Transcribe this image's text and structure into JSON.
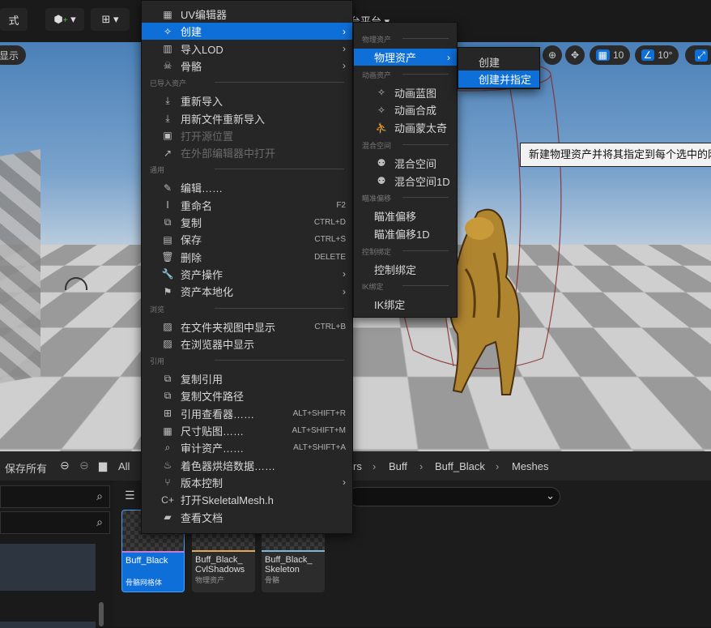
{
  "toolbar": {
    "mode_label": "式",
    "platform_label": "台平台"
  },
  "viewport": {
    "show_label": "显示",
    "grid_value": "10",
    "angle_value": "10°",
    "tooltip": "新建物理资产并将其指定到每个选中的网格"
  },
  "context_menu": {
    "items": [
      {
        "icon": "grid-icon",
        "glyph": "▦",
        "label": "UV编辑器"
      },
      {
        "icon": "create-icon",
        "glyph": "✧",
        "label": "创建",
        "highlight": true,
        "submenu": true
      },
      {
        "icon": "import-lod-icon",
        "glyph": "▥",
        "label": "导入LOD",
        "submenu": true
      },
      {
        "icon": "skeleton-icon",
        "glyph": "☠",
        "label": "骨骼",
        "submenu": true
      },
      {
        "section": "已导入资产"
      },
      {
        "icon": "reimport-icon",
        "glyph": "⤓",
        "label": "重新导入"
      },
      {
        "icon": "reimport-new-file-icon",
        "glyph": "⤓",
        "label": "用新文件重新导入"
      },
      {
        "icon": "open-source-icon",
        "glyph": "▣",
        "label": "打开源位置",
        "disabled": true
      },
      {
        "icon": "external-editor-icon",
        "glyph": "↗",
        "label": "在外部编辑器中打开",
        "disabled": true
      },
      {
        "section": "通用"
      },
      {
        "icon": "edit-icon",
        "glyph": "✎",
        "label": "编辑……"
      },
      {
        "icon": "rename-icon",
        "glyph": "Ⅰ",
        "label": "重命名",
        "shortcut": "F2"
      },
      {
        "icon": "duplicate-icon",
        "glyph": "⧉",
        "label": "复制",
        "shortcut": "CTRL+D"
      },
      {
        "icon": "save-icon",
        "glyph": "▤",
        "label": "保存",
        "shortcut": "CTRL+S"
      },
      {
        "icon": "delete-icon",
        "glyph": "🗑",
        "label": "删除",
        "shortcut": "DELETE"
      },
      {
        "icon": "wrench-icon",
        "glyph": "🔧",
        "label": "资产操作",
        "submenu": true
      },
      {
        "icon": "flag-icon",
        "glyph": "⚑",
        "label": "资产本地化",
        "submenu": true
      },
      {
        "section": "浏览"
      },
      {
        "icon": "folder-search-icon",
        "glyph": "▨",
        "label": "在文件夹视图中显示",
        "shortcut": "CTRL+B"
      },
      {
        "icon": "browser-search-icon",
        "glyph": "▨",
        "label": "在浏览器中显示"
      },
      {
        "section": "引用"
      },
      {
        "icon": "copy-ref-icon",
        "glyph": "⧉",
        "label": "复制引用"
      },
      {
        "icon": "copy-path-icon",
        "glyph": "⧉",
        "label": "复制文件路径"
      },
      {
        "icon": "ref-viewer-icon",
        "glyph": "⊞",
        "label": "引用查看器……",
        "shortcut": "ALT+SHIFT+R"
      },
      {
        "icon": "size-map-icon",
        "glyph": "▦",
        "label": "尺寸贴图……",
        "shortcut": "ALT+SHIFT+M"
      },
      {
        "icon": "audit-icon",
        "glyph": "⌕",
        "label": "审计资产……",
        "shortcut": "ALT+SHIFT+A"
      },
      {
        "icon": "shader-bake-icon",
        "glyph": "♨",
        "label": "着色器烘焙数据……"
      },
      {
        "icon": "version-control-icon",
        "glyph": "⑂",
        "label": "版本控制",
        "submenu": true
      },
      {
        "icon": "cpp-file-icon",
        "glyph": "C+",
        "label": "打开SkeletalMesh.h"
      },
      {
        "icon": "docs-icon",
        "glyph": "▰",
        "label": "查看文档"
      }
    ]
  },
  "create_menu": {
    "items": [
      {
        "section": "物理资产"
      },
      {
        "label": "物理资产",
        "highlight": true,
        "submenu": true
      },
      {
        "section": "动画资产"
      },
      {
        "icon": "anim-blueprint-icon",
        "glyph": "✧",
        "label": "动画蓝图"
      },
      {
        "icon": "anim-composite-icon",
        "glyph": "✧",
        "label": "动画合成"
      },
      {
        "icon": "anim-montage-icon",
        "glyph": "⛹",
        "label": "动画蒙太奇"
      },
      {
        "section": "混合空间"
      },
      {
        "icon": "blend-space-icon",
        "glyph": "⚉",
        "label": "混合空间"
      },
      {
        "icon": "blend-space-1d-icon",
        "glyph": "⚉",
        "label": "混合空间1D"
      },
      {
        "section": "瞄准偏移"
      },
      {
        "label": "瞄准偏移"
      },
      {
        "label": "瞄准偏移1D"
      },
      {
        "section": "控制绑定"
      },
      {
        "label": "控制绑定"
      },
      {
        "section": "IK绑定"
      },
      {
        "label": "IK绑定"
      }
    ]
  },
  "physics_menu": {
    "items": [
      {
        "label": "创建"
      },
      {
        "label": "创建并指定",
        "highlight": true
      }
    ]
  },
  "content_browser": {
    "save_all": "保存所有",
    "all_label": "All",
    "breadcrumbs": [
      "rs",
      "Buff",
      "Buff_Black",
      "Meshes"
    ],
    "assets": [
      {
        "name": "Buff_Black",
        "type": "骨骼网格体",
        "selected": true,
        "accent": "#c57ad8"
      },
      {
        "name": "Buff_Black_\nCvlShadows",
        "type": "物理资产",
        "selected": false,
        "accent": "#e0a860"
      },
      {
        "name": "Buff_Black_\nSkeleton",
        "type": "骨骼",
        "selected": false,
        "accent": "#7ab8d8"
      }
    ]
  },
  "colors": {
    "highlight": "#0f6fd8",
    "menu_bg": "#262626"
  }
}
